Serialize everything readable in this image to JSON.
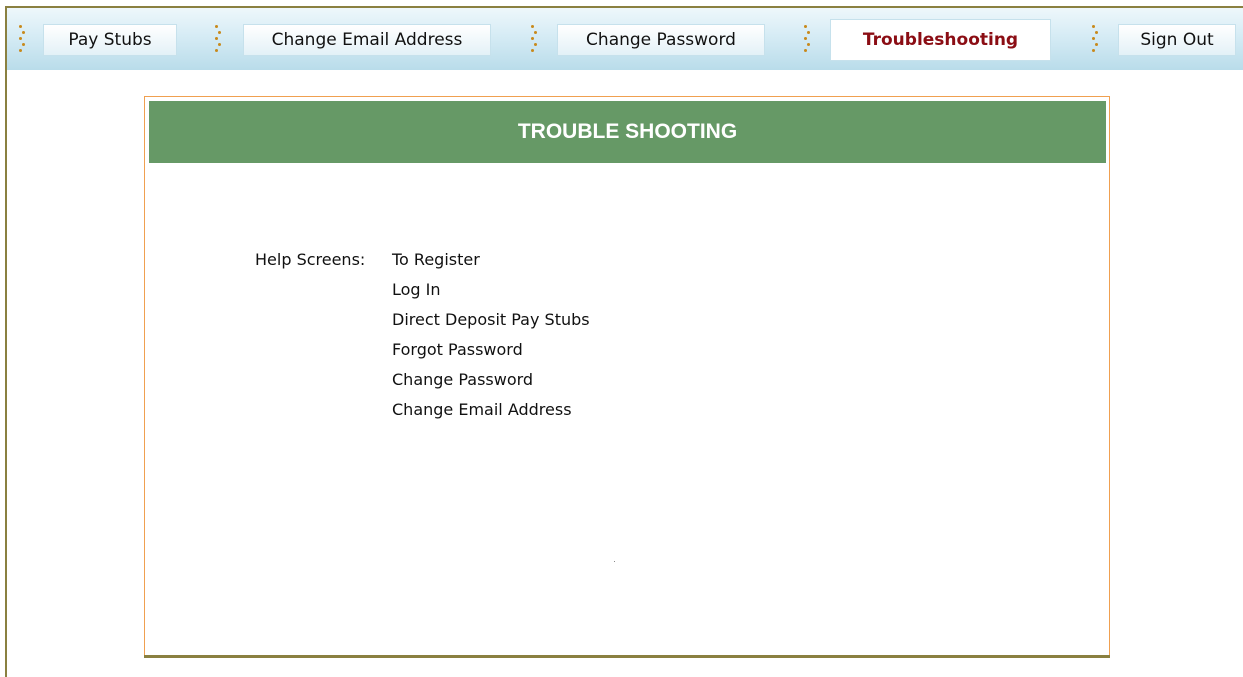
{
  "nav": {
    "items": [
      {
        "label": "Pay Stubs"
      },
      {
        "label": "Change Email Address"
      },
      {
        "label": "Change Password"
      },
      {
        "label": "Troubleshooting",
        "active": true
      },
      {
        "label": "Sign Out"
      }
    ]
  },
  "panel": {
    "title": "TROUBLE SHOOTING",
    "help_label": "Help Screens:",
    "help_links": [
      "To Register",
      "Log In",
      "Direct Deposit Pay Stubs",
      "Forgot Password",
      "Change Password",
      "Change Email Address"
    ]
  },
  "colors": {
    "header_green": "#669966",
    "active_tab_text": "#8b0d14",
    "panel_border": "#f0a050",
    "frame_border": "#8a8040",
    "separator_dots": "#c88a1c"
  },
  "icons": [
    "dotted-separator-icon"
  ]
}
